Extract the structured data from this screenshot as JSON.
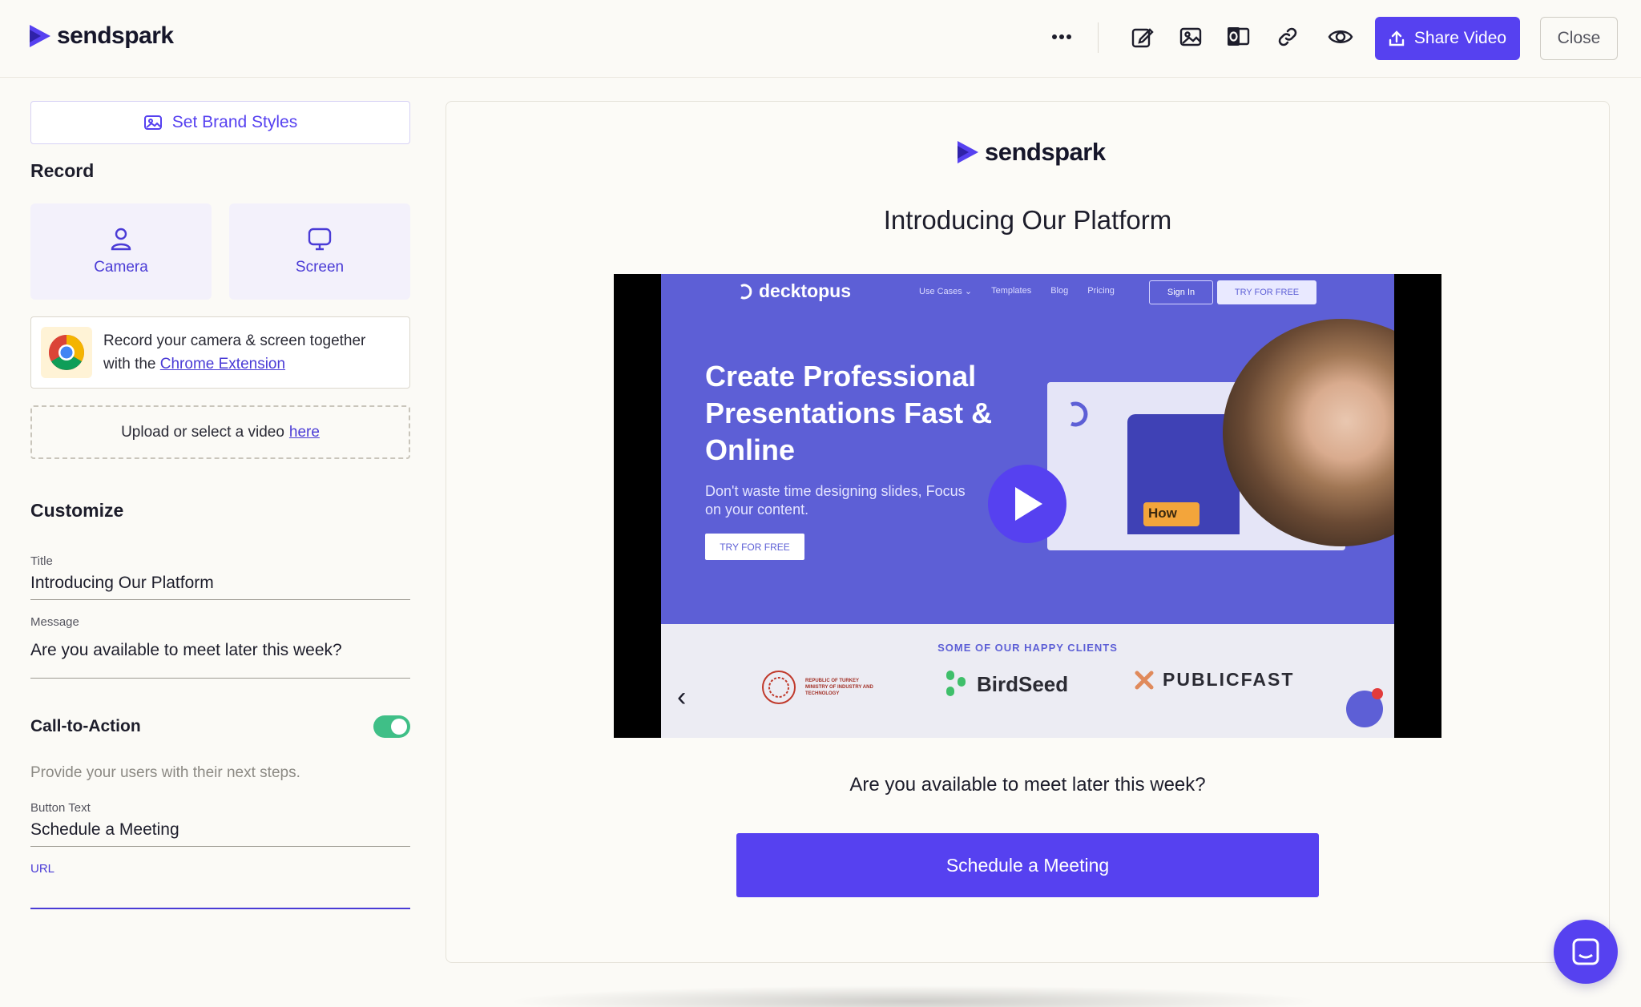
{
  "header": {
    "logo_text": "sendspark",
    "share_label": "Share Video",
    "close_label": "Close",
    "icons": [
      "more-icon",
      "edit-icon",
      "image-icon",
      "outlook-icon",
      "link-icon",
      "eye-icon",
      "upload-icon"
    ]
  },
  "sidebar": {
    "brand_styles_label": "Set Brand Styles",
    "record_title": "Record",
    "camera_label": "Camera",
    "screen_label": "Screen",
    "chrome_text_1": "Record your camera & screen together",
    "chrome_text_2": "with the",
    "chrome_link": "Chrome Extension",
    "upload_text": "Upload or select a video",
    "upload_link": "here",
    "customize_title": "Customize",
    "title_label": "Title",
    "title_value": "Introducing Our Platform",
    "message_label": "Message",
    "message_value": "Are you available to meet later this week?",
    "cta_title": "Call-to-Action",
    "cta_enabled": true,
    "cta_description": "Provide your users with their next steps.",
    "button_text_label": "Button Text",
    "button_text_value": "Schedule a Meeting",
    "url_label": "URL",
    "url_value": ""
  },
  "preview": {
    "logo_text": "sendspark",
    "title": "Introducing Our Platform",
    "message": "Are you available to meet later this week?",
    "button_label": "Schedule a Meeting",
    "video": {
      "brand": "decktopus",
      "nav_links": [
        "Use Cases ⌄",
        "Templates",
        "Blog",
        "Pricing"
      ],
      "signin": "Sign In",
      "try_free": "TRY FOR FREE",
      "headline": "Create Professional Presentations Fast & Online",
      "subtext": "Don't waste time designing slides, Focus on your content.",
      "cta": "TRY FOR FREE",
      "laptop_badge": "How",
      "clients_title": "SOME OF OUR HAPPY CLIENTS",
      "client_1": "REPUBLIC OF TURKEY MINISTRY OF INDUSTRY AND TECHNOLOGY",
      "client_2": "BirdSeed",
      "client_3": "PUBLICFAST"
    }
  },
  "colors": {
    "accent": "#5641f0",
    "toggle_on": "#3fbf87",
    "background": "#fbfaf6"
  }
}
